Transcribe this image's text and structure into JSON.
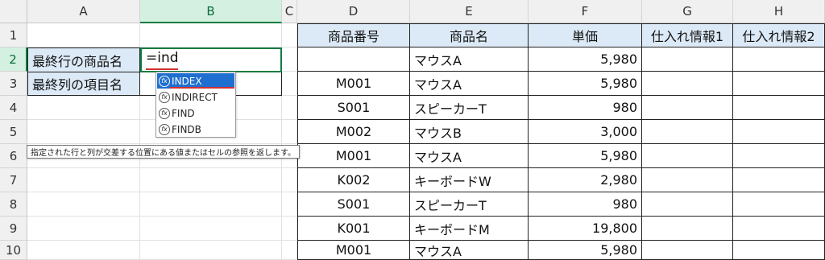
{
  "columns": [
    "A",
    "B",
    "C",
    "D",
    "E",
    "F",
    "G",
    "H"
  ],
  "rows": [
    "1",
    "2",
    "3",
    "4",
    "5",
    "6",
    "7",
    "8",
    "9",
    "10"
  ],
  "labels": {
    "a2": "最終行の商品名",
    "a3": "最終列の項目名"
  },
  "formula_input": "=ind",
  "autocomplete": {
    "items": [
      "INDEX",
      "INDIRECT",
      "FIND",
      "FINDB"
    ],
    "selected": "INDEX",
    "icon": "function-icon"
  },
  "tooltip": "指定された行と列が交差する位置にある値またはセルの参照を返します。",
  "table": {
    "headers": [
      "商品番号",
      "商品名",
      "単価",
      "仕入れ情報1",
      "仕入れ情報2"
    ],
    "rows": [
      [
        "",
        "マウスA",
        "5,980",
        "",
        ""
      ],
      [
        "M001",
        "マウスA",
        "5,980",
        "",
        ""
      ],
      [
        "S001",
        "スピーカーT",
        "980",
        "",
        ""
      ],
      [
        "M002",
        "マウスB",
        "3,000",
        "",
        ""
      ],
      [
        "M001",
        "マウスA",
        "5,980",
        "",
        ""
      ],
      [
        "K002",
        "キーボードW",
        "2,980",
        "",
        ""
      ],
      [
        "S001",
        "スピーカーT",
        "980",
        "",
        ""
      ],
      [
        "K001",
        "キーボードM",
        "19,800",
        "",
        ""
      ],
      [
        "M001",
        "マウスA",
        "5,980",
        "",
        ""
      ]
    ]
  },
  "colors": {
    "header_fill": "#dce9f6",
    "selection_green": "#107c41",
    "autocomplete_highlight": "#1f6fd1",
    "error_underline": "#d23030"
  }
}
